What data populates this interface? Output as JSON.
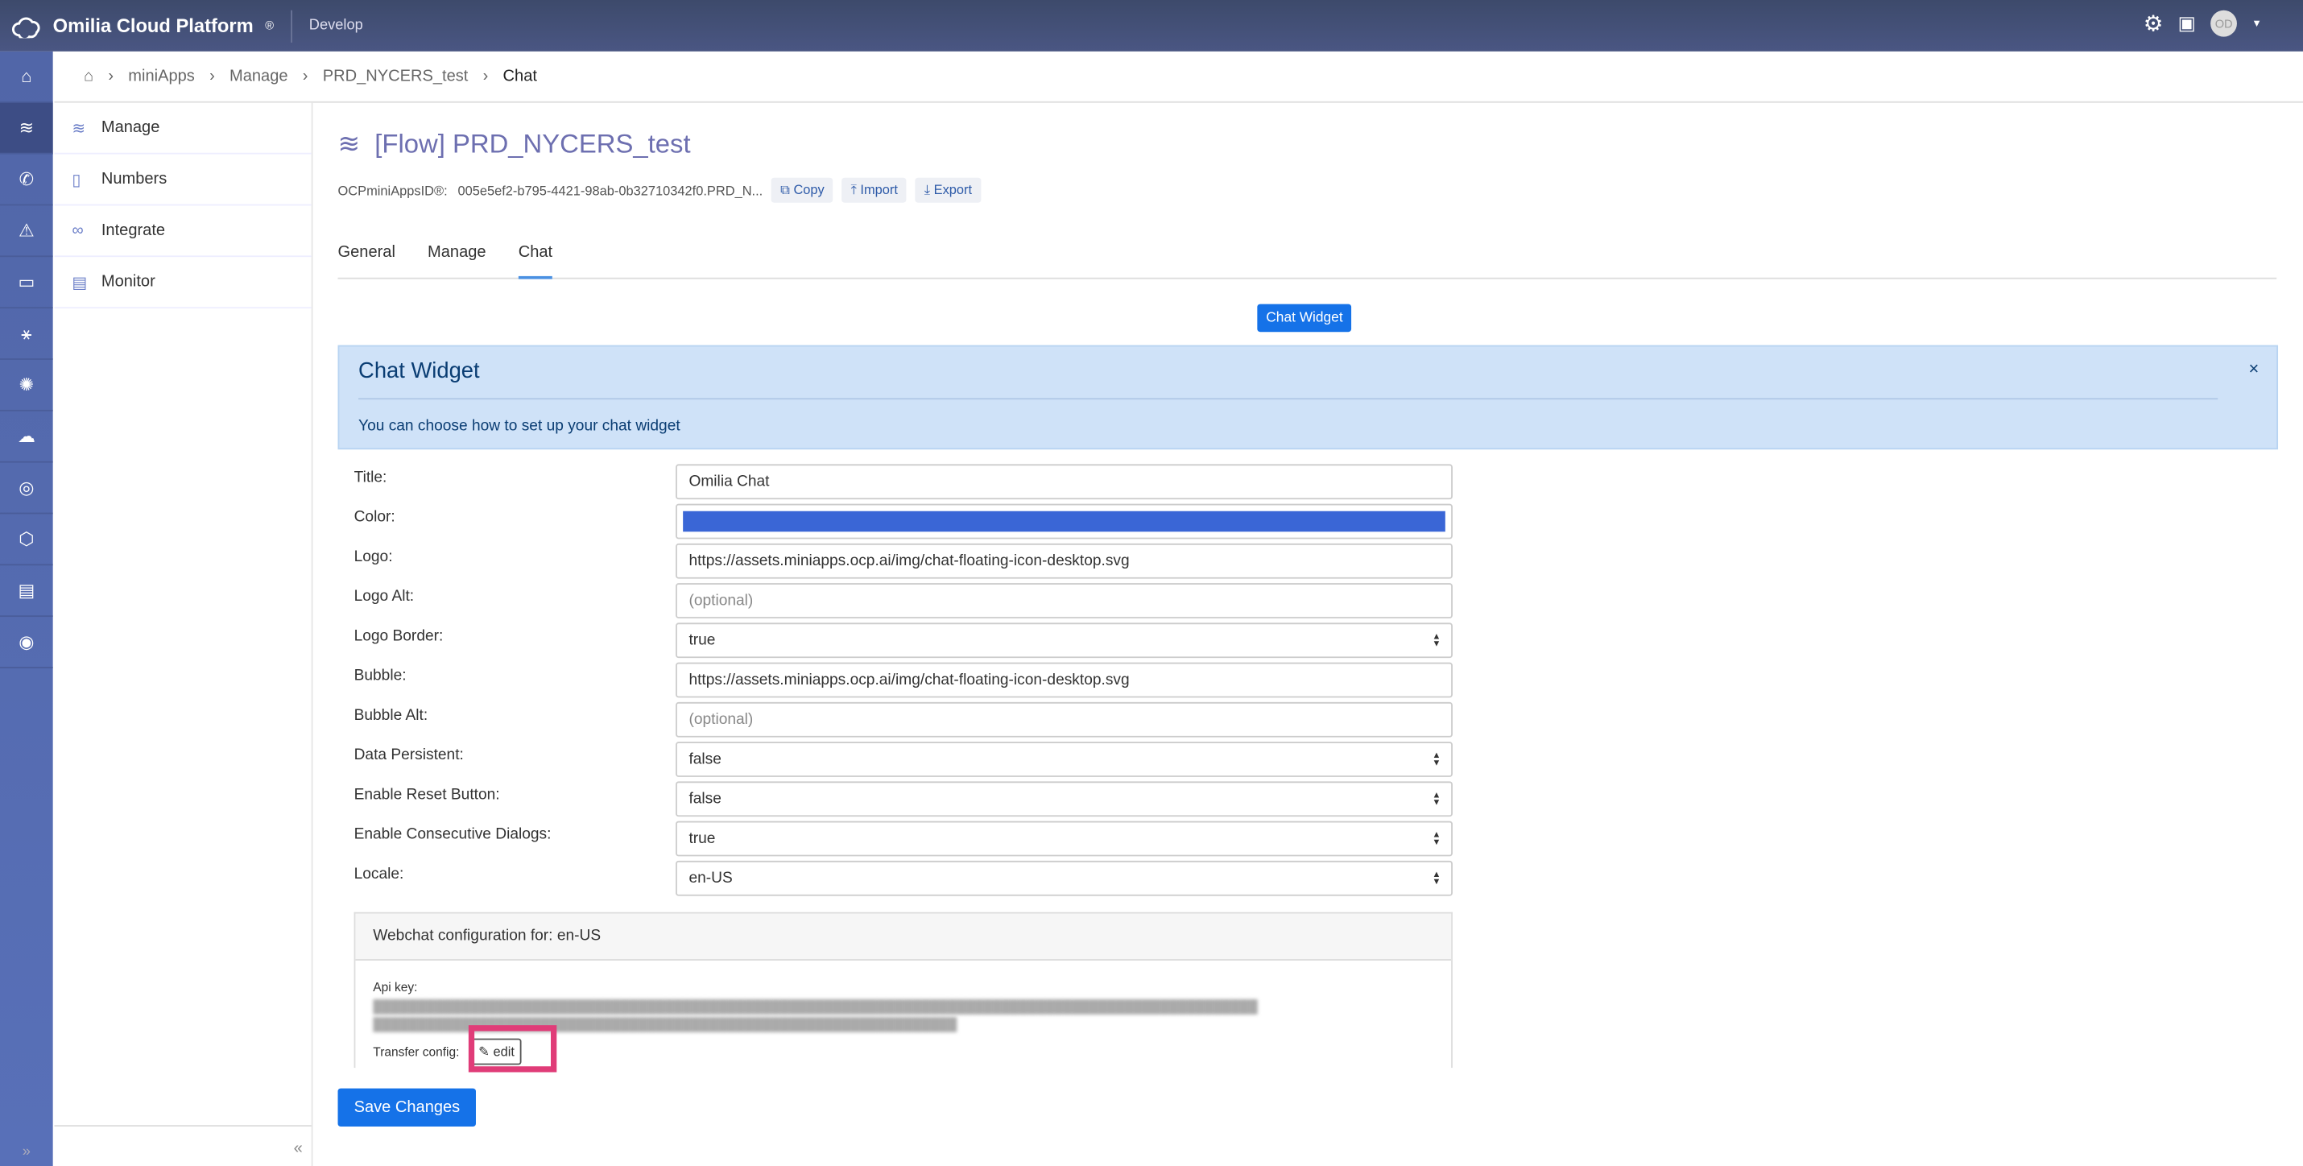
{
  "header": {
    "brand": "Omilia Cloud Platform",
    "reg": "®",
    "env": "Develop",
    "avatar": "OD"
  },
  "rail": [
    "home-icon",
    "manage-icon",
    "numbers-icon",
    "deploy-icon",
    "monitor-icon",
    "network-icon",
    "ideas-icon",
    "cloud-icon",
    "users-icon",
    "security-icon",
    "billing-icon",
    "support-icon"
  ],
  "breadcrumb": [
    "miniApps",
    "Manage",
    "PRD_NYCERS_test",
    "Chat"
  ],
  "sidebar": [
    {
      "label": "Manage",
      "icon": "≋"
    },
    {
      "label": "Numbers",
      "icon": "▯"
    },
    {
      "label": "Integrate",
      "icon": "∞"
    },
    {
      "label": "Monitor",
      "icon": "▤"
    }
  ],
  "page": {
    "title": "[Flow] PRD_NYCERS_test",
    "id_label": "OCPminiAppsID®:",
    "id_value": "005e5ef2-b795-4421-98ab-0b32710342f0.PRD_N...",
    "copy": "Copy",
    "import": "Import",
    "export": "Export"
  },
  "tabs": [
    "General",
    "Manage",
    "Chat"
  ],
  "chat_widget_button": "Chat Widget",
  "alert": {
    "title": "Chat Widget",
    "text": "You can choose how to set up your chat widget",
    "close": "×"
  },
  "form": [
    {
      "label": "Title:",
      "value": "Omilia Chat"
    },
    {
      "label": "Color:",
      "value": "",
      "color": "#3a66d6"
    },
    {
      "label": "Logo:",
      "value": "https://assets.miniapps.ocp.ai/img/chat-floating-icon-desktop.svg"
    },
    {
      "label": "Logo Alt:",
      "placeholder": "(optional)"
    },
    {
      "label": "Logo Border:",
      "value": "true",
      "select": true
    },
    {
      "label": "Bubble:",
      "value": "https://assets.miniapps.ocp.ai/img/chat-floating-icon-desktop.svg"
    },
    {
      "label": "Bubble Alt:",
      "placeholder": "(optional)"
    },
    {
      "label": "Data Persistent:",
      "value": "false",
      "select": true
    },
    {
      "label": "Enable Reset Button:",
      "value": "false",
      "select": true
    },
    {
      "label": "Enable Consecutive Dialogs:",
      "value": "true",
      "select": true
    },
    {
      "label": "Locale:",
      "value": "en-US",
      "select": true
    }
  ],
  "webchat": {
    "header": "Webchat configuration for: en-US",
    "api_key_label": "Api key:",
    "transfer_label": "Transfer config:",
    "edit": "edit"
  },
  "save": "Save Changes"
}
